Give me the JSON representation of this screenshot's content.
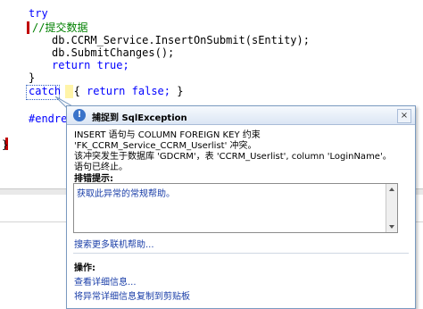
{
  "code": {
    "line_try": "try",
    "line_comment": "//提交数据",
    "line_insert": "db.CCRM_Service.InsertOnSubmit(sEntity);",
    "line_submit": "db.SubmitChanges();",
    "line_return_kw": "return",
    "line_return_val": "true;",
    "line_close": "}",
    "line_catch": "catch",
    "line_catch_body_open": "{",
    "line_catch_return": "return",
    "line_catch_false": "false;",
    "line_catch_close": "}",
    "line_endregion": "#endregion",
    "line_brace_bottom": "}"
  },
  "popup": {
    "icon": "exception-warning-icon",
    "title": "捕捉到 SqlException",
    "close_label": "×",
    "message_line1": "INSERT 语句与 COLUMN FOREIGN KEY 约束 'FK_CCRM_Service_CCRM_Userlist' 冲突。",
    "message_line2": "该冲突发生于数据库 'GDCRM'，表 'CCRM_Userlist', column 'LoginName'。",
    "message_line3": "语句已终止。",
    "hint_label": "排错提示:",
    "hint_text": "获取此异常的常规帮助。",
    "search_link": "搜索更多联机帮助...",
    "actions_label": "操作:",
    "view_detail_link": "查看详细信息...",
    "copy_detail_link": "将异常详细信息复制到剪贴板"
  },
  "colors": {
    "keyword": "#0000ff",
    "comment": "#008000",
    "marker": "#c00000",
    "link": "#1a3ea8",
    "title_bar": "#dbe6f4"
  }
}
